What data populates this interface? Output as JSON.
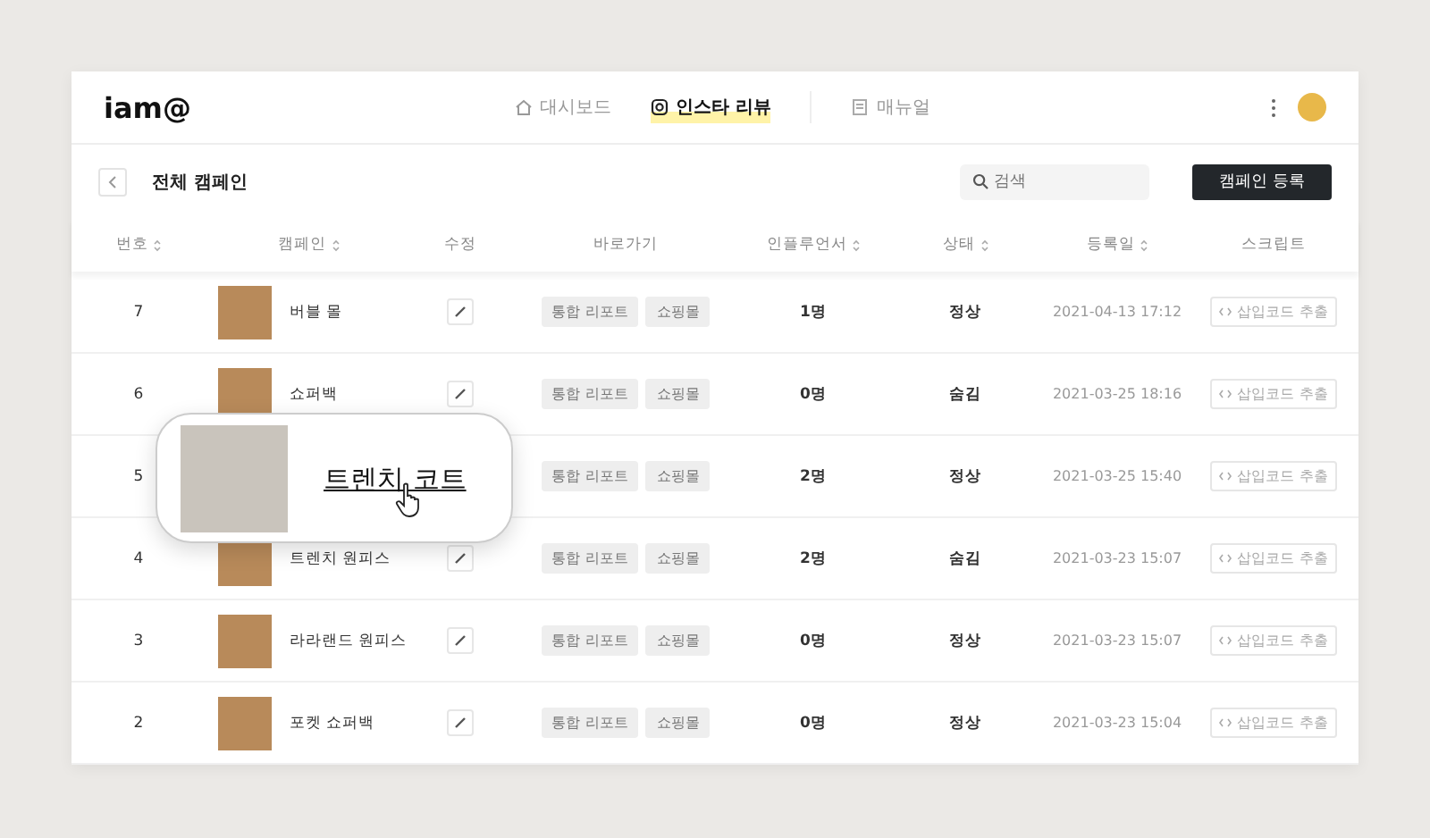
{
  "logo": "iam@",
  "nav": [
    {
      "label": "대시보드",
      "selected": false
    },
    {
      "label": "인스타 리뷰",
      "selected": true
    },
    {
      "label": "매뉴얼",
      "selected": false
    }
  ],
  "page_title": "전체 캠페인",
  "search": {
    "placeholder": "검색"
  },
  "create_button": "캠페인 등록",
  "table": {
    "columns": [
      {
        "label": "번호",
        "sortable": true
      },
      {
        "label": "캠페인",
        "sortable": true
      },
      {
        "label": "수정",
        "sortable": false
      },
      {
        "label": "바로가기",
        "sortable": false
      },
      {
        "label": "인플루언서",
        "sortable": true
      },
      {
        "label": "상태",
        "sortable": true
      },
      {
        "label": "등록일",
        "sortable": true
      },
      {
        "label": "스크립트",
        "sortable": false
      }
    ],
    "rows": [
      {
        "number": "7",
        "name": "버블 몰",
        "links": [
          "통합 리포트",
          "쇼핑몰"
        ],
        "influencers": "1명",
        "status": "정상",
        "date": "2021-04-13 17:12",
        "script": "삽입코드 추출"
      },
      {
        "number": "6",
        "name": "쇼퍼백",
        "links": [
          "통합 리포트",
          "쇼핑몰"
        ],
        "influencers": "0명",
        "status": "숨김",
        "date": "2021-03-25 18:16",
        "script": "삽입코드 추출"
      },
      {
        "number": "5",
        "links": [
          "통합 리포트",
          "쇼핑몰"
        ],
        "influencers": "2명",
        "status": "정상",
        "date": "2021-03-25 15:40",
        "script": "삽입코드 추출"
      },
      {
        "number": "4",
        "name": "트렌치 원피스",
        "links": [
          "통합 리포트",
          "쇼핑몰"
        ],
        "influencers": "2명",
        "status": "숨김",
        "date": "2021-03-23 15:07",
        "script": "삽입코드 추출"
      },
      {
        "number": "3",
        "name": "라라랜드 원피스",
        "links": [
          "통합 리포트",
          "쇼핑몰"
        ],
        "influencers": "0명",
        "status": "정상",
        "date": "2021-03-23 15:07",
        "script": "삽입코드 추출"
      },
      {
        "number": "2",
        "name": "포켓 쇼퍼백",
        "links": [
          "통합 리포트",
          "쇼핑몰"
        ],
        "influencers": "0명",
        "status": "정상",
        "date": "2021-03-23 15:04",
        "script": "삽입코드 추출"
      }
    ]
  },
  "hover_preview": {
    "title": "트렌치 코트"
  }
}
